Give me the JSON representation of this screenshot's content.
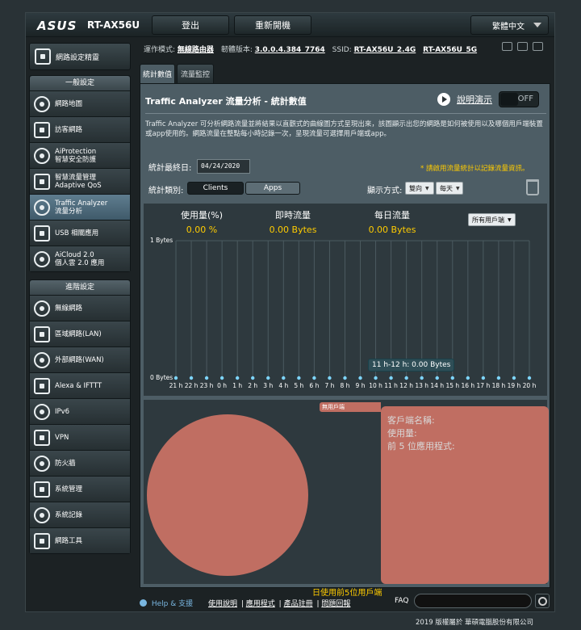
{
  "header": {
    "brand": "ASUS",
    "model": "RT-AX56U",
    "logout": "登出",
    "reboot": "重新開機",
    "language": "繁體中文"
  },
  "infoline": {
    "mode_label": "運作模式:",
    "mode_value": "無線路由器",
    "fw_label": "韌體版本:",
    "fw_value": "3.0.0.4.384_7764",
    "ssid_label": "SSID:",
    "ssid_24": "RT-AX56U_2.4G",
    "ssid_5": "RT-AX56U_5G"
  },
  "sidebar": {
    "quick_setup": "網路設定精靈",
    "general_title": "一般設定",
    "general": [
      {
        "label": "網路地圖",
        "icon": "network-map-icon"
      },
      {
        "label": "訪客網路",
        "icon": "guest-network-icon"
      },
      {
        "label": "AiProtection\n智慧安全防護",
        "icon": "aiprotection-icon"
      },
      {
        "label": "智慧流量管理\nAdaptive QoS",
        "icon": "qos-icon"
      },
      {
        "label": "Traffic Analyzer\n流量分析",
        "icon": "traffic-analyzer-icon"
      },
      {
        "label": "USB 相關應用",
        "icon": "usb-icon"
      },
      {
        "label": "AiCloud 2.0\n個人雲 2.0 應用",
        "icon": "aicloud-icon"
      }
    ],
    "advanced_title": "進階設定",
    "advanced": [
      {
        "label": "無線網路",
        "icon": "wireless-icon"
      },
      {
        "label": "區域網路(LAN)",
        "icon": "lan-icon"
      },
      {
        "label": "外部網路(WAN)",
        "icon": "wan-icon"
      },
      {
        "label": "Alexa & IFTTT",
        "icon": "alexa-icon"
      },
      {
        "label": "IPv6",
        "icon": "ipv6-icon"
      },
      {
        "label": "VPN",
        "icon": "vpn-icon"
      },
      {
        "label": "防火牆",
        "icon": "firewall-icon"
      },
      {
        "label": "系統管理",
        "icon": "administration-icon"
      },
      {
        "label": "系統記錄",
        "icon": "system-log-icon"
      },
      {
        "label": "網路工具",
        "icon": "network-tools-icon"
      }
    ]
  },
  "tabs": [
    "統計數值",
    "流量監控"
  ],
  "panel": {
    "title": "Traffic Analyzer 流量分析 - 統計數值",
    "demo_link": "說明演示",
    "toggle": "OFF",
    "description": "Traffic Analyzer 可分析網路流量並將結果以直觀式的曲線圖方式呈現出來，該圖顯示出您的網路是如何被使用以及哪個用戶端裝置或app使用的。網路流量在整點每小時記錄一次，呈現流量可選擇用戶端或app。",
    "end_date_label": "統計最終日:",
    "end_date": "04/24/2020",
    "note": "* 請啟用流量統計以記錄流量資訊。",
    "category_label": "統計類別:",
    "cat_clients": "Clients",
    "cat_apps": "Apps",
    "display_label": "顯示方式:",
    "direction": "雙向",
    "period": "每天"
  },
  "chart_data": {
    "type": "line",
    "x": [
      "21 h",
      "22 h",
      "23 h",
      "0 h",
      "1 h",
      "2 h",
      "3 h",
      "4 h",
      "5 h",
      "6 h",
      "7 h",
      "8 h",
      "9 h",
      "10 h",
      "11 h",
      "12 h",
      "13 h",
      "14 h",
      "15 h",
      "16 h",
      "17 h",
      "18 h",
      "19 h",
      "20 h"
    ],
    "series": [
      {
        "values": [
          0,
          0,
          0,
          0,
          0,
          0,
          0,
          0,
          0,
          0,
          0,
          0,
          0,
          0,
          0,
          0,
          0,
          0,
          0,
          0,
          0,
          0,
          0,
          0
        ]
      }
    ],
    "y_ticks": [
      "1 Bytes",
      "0 Bytes"
    ],
    "tooltip": "11 h-12 h: 0.00 Bytes",
    "stats": [
      {
        "label": "使用量(%)",
        "value": "0.00 %"
      },
      {
        "label": "即時流量",
        "value": "0.00 Bytes"
      },
      {
        "label": "每日流量",
        "value": "0.00 Bytes"
      }
    ],
    "client_filter": "所有用戶端"
  },
  "pie": {
    "tag": "無用戶端",
    "client_name": "客戶端名稱:",
    "usage": "使用量:",
    "top5": "前 5 位應用程式:",
    "legend": "日使用前5位用戶端",
    "color": "#c06e62"
  },
  "footer": {
    "help": "Help & 支援",
    "manual": "使用說明",
    "utility": "應用程式",
    "registration": "產品註冊",
    "feedback": "問題回報",
    "faq": "FAQ",
    "copyright": "2019 版權屬於 華碩電腦股份有限公司"
  }
}
